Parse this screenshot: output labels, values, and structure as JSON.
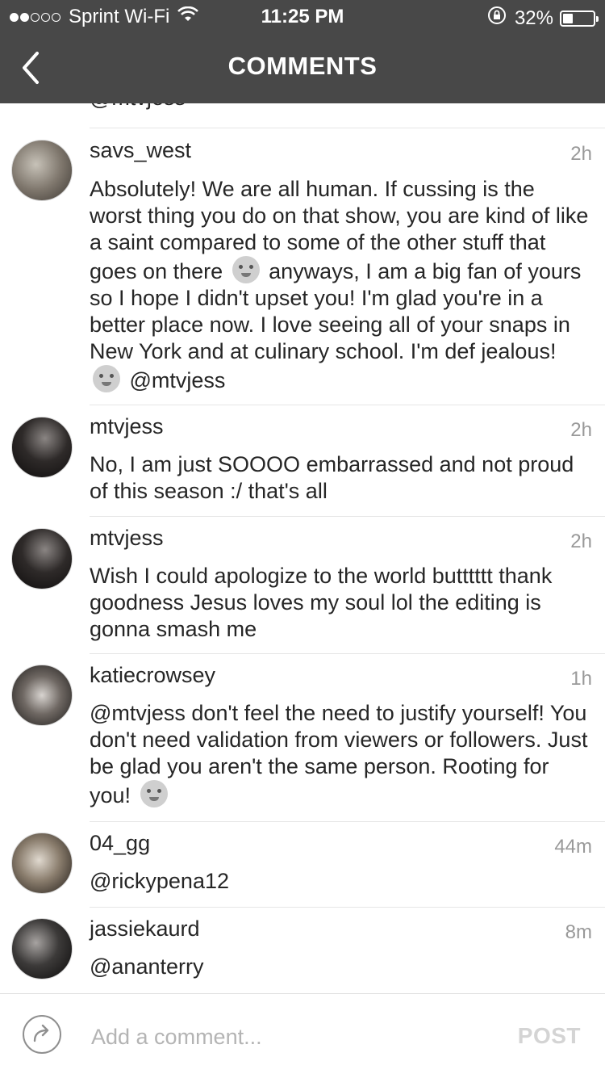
{
  "status_bar": {
    "carrier": "Sprint Wi-Fi",
    "time": "11:25 PM",
    "battery": "32%",
    "battery_level": 0.32,
    "signal_bars_filled": 2
  },
  "header": {
    "title": "COMMENTS",
    "back_icon": "chevron-left-icon"
  },
  "previous_tail": "@mtvjess",
  "comments": [
    {
      "user": "savs_west",
      "time": "2h",
      "text_parts": [
        "Absolutely! We are all human. If cussing is the worst thing you do on that show, you are kind of like a saint compared to some of the other stuff that goes on there",
        "anyways, I am a big fan of yours so I hope I didn't upset you! I'm glad you're in a better place now. I love seeing all of your snaps in New York and at culinary school. I'm def jealous!",
        "@mtvjess"
      ],
      "emojis": [
        "winking-tongue-emoji",
        "kiss-emoji"
      ]
    },
    {
      "user": "mtvjess",
      "time": "2h",
      "text": "No, I am just SOOOO embarrassed and not proud of this season :/ that's all"
    },
    {
      "user": "mtvjess",
      "time": "2h",
      "text": "Wish I could apologize to the world butttttt thank goodness Jesus loves my soul lol the editing is gonna smash me"
    },
    {
      "user": "katiecrowsey",
      "time": "1h",
      "text": "@mtvjess don't feel the need to justify yourself! You don't need validation from viewers or followers. Just be glad you aren't the same person. Rooting for you!",
      "emojis": [
        "kiss-emoji"
      ]
    },
    {
      "user": "04_gg",
      "time": "44m",
      "text": "@rickypena12"
    },
    {
      "user": "jassiekaurd",
      "time": "8m",
      "text": "@ananterry"
    }
  ],
  "footer": {
    "placeholder": "Add a comment...",
    "post_label": "POST",
    "share_icon": "share-arrow-icon"
  },
  "colors": {
    "header_bg": "#484848",
    "text": "#262626",
    "muted": "#999999",
    "post_disabled": "#d4d4d4"
  }
}
